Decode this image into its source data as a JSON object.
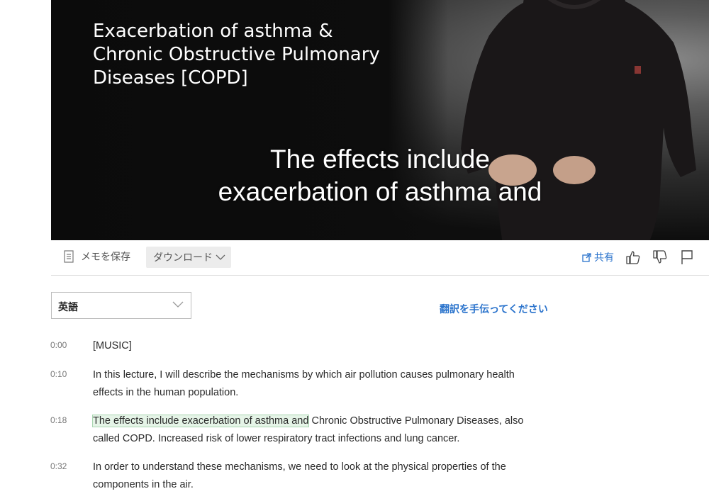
{
  "video": {
    "slide_title": "Exacerbation of asthma &\nChronic Obstructive Pulmonary\nDiseases [COPD]",
    "caption_lines": [
      "The effects include",
      "exacerbation of asthma and"
    ]
  },
  "toolbar": {
    "save_note_label": "メモを保存",
    "download_label": "ダウンロード",
    "share_label": "共有"
  },
  "language": {
    "selected": "英語",
    "help_translate": "翻訳を手伝ってください"
  },
  "transcript": [
    {
      "time": "0:00",
      "text": "[MUSIC]"
    },
    {
      "time": "0:10",
      "text": "In this lecture, I will describe the mechanisms by which air pollution causes pulmonary health effects in the human population."
    },
    {
      "time": "0:18",
      "highlight": "The effects include exacerbation of asthma and",
      "rest": " Chronic Obstructive Pulmonary Diseases, also called COPD. Increased risk of lower respiratory tract infections and lung cancer."
    },
    {
      "time": "0:32",
      "text": "In order to understand these mechanisms, we need to look at the physical properties of the components in the air."
    }
  ],
  "colors": {
    "accent": "#2a73cc",
    "highlight": "#e5f4e7"
  }
}
